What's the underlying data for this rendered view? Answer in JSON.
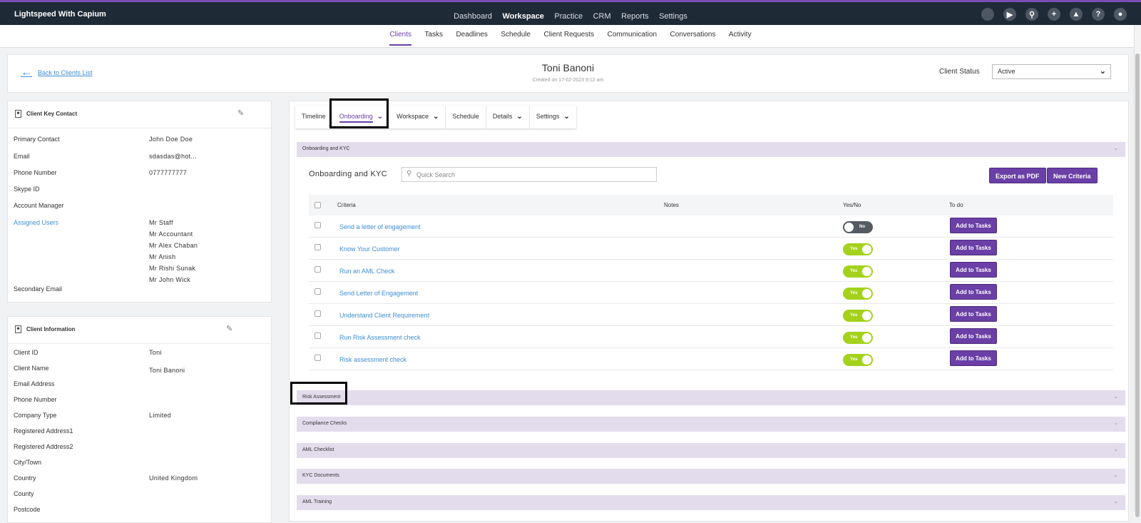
{
  "app": {
    "brand": "Lightspeed With Capium",
    "top_nav": [
      "Dashboard",
      "Workspace",
      "Practice",
      "CRM",
      "Reports",
      "Settings"
    ],
    "top_nav_active": "Workspace",
    "sub_nav": [
      "Clients",
      "Tasks",
      "Deadlines",
      "Schedule",
      "Client Requests",
      "Communication",
      "Conversations",
      "Activity"
    ],
    "sub_nav_active": "Clients",
    "icons": [
      "notification-dot-icon",
      "megaphone-icon",
      "search-icon",
      "plus-icon",
      "rocket-icon",
      "help-icon",
      "user-icon"
    ]
  },
  "header": {
    "back_label": "Back to Clients List",
    "client_name": "Toni Banoni",
    "created": "Created on 17-02-2023 9:12 am",
    "status_label": "Client Status",
    "status_value": "Active"
  },
  "key_contact": {
    "title": "Client Key Contact",
    "rows": [
      {
        "label": "Primary Contact",
        "value": "John Doe Doe"
      },
      {
        "label": "Email",
        "value": "sdasdas@hot..."
      },
      {
        "label": "Phone Number",
        "value": "0777777777"
      },
      {
        "label": "Skype ID",
        "value": ""
      },
      {
        "label": "Account Manager",
        "value": ""
      }
    ],
    "assigned_label": "Assigned Users",
    "assigned_users": [
      "Mr Staff",
      "Mr Accountant",
      "Mr Alex Chaban",
      "Mr Anish",
      "Mr Rishi Sunak",
      "Mr John Wick"
    ],
    "secondary_email_label": "Secondary Email"
  },
  "client_info": {
    "title": "Client Information",
    "rows": [
      {
        "label": "Client ID",
        "value": "Toni"
      },
      {
        "label": "Client Name",
        "value": "Toni Banoni"
      },
      {
        "label": "Email Address",
        "value": ""
      },
      {
        "label": "Phone Number",
        "value": ""
      },
      {
        "label": "Company Type",
        "value": "Limited"
      },
      {
        "label": "Registered Address1",
        "value": ""
      },
      {
        "label": "Registered Address2",
        "value": ""
      },
      {
        "label": "City/Town",
        "value": ""
      },
      {
        "label": "Country",
        "value": "United Kingdom"
      },
      {
        "label": "County",
        "value": ""
      },
      {
        "label": "Postcode",
        "value": ""
      }
    ]
  },
  "tabs": {
    "timeline": "Timeline",
    "onboarding": "Onboarding",
    "workspace": "Workspace",
    "schedule": "Schedule",
    "details": "Details",
    "settings": "Settings",
    "active": "Onboarding"
  },
  "onboarding": {
    "section_title": "Onboarding and KYC",
    "inner_title": "Onboarding and KYC",
    "search_placeholder": "Quick Search",
    "export_label": "Export as PDF",
    "new_criteria_label": "New Criteria",
    "columns": {
      "criteria": "Criteria",
      "notes": "Notes",
      "yesno": "Yes/No",
      "todo": "To do"
    },
    "add_label": "Add to Tasks",
    "rows": [
      {
        "criteria": "Send a letter of engagement",
        "state": "No"
      },
      {
        "criteria": "Know Your Customer",
        "state": "Yes"
      },
      {
        "criteria": "Run an AML Check",
        "state": "Yes"
      },
      {
        "criteria": "Send Letter of Engagement",
        "state": "Yes"
      },
      {
        "criteria": "Understand Client Requirement",
        "state": "Yes"
      },
      {
        "criteria": "Run Risk Assessment check",
        "state": "Yes"
      },
      {
        "criteria": "Risk assessment check",
        "state": "Yes"
      }
    ]
  },
  "sections": [
    "Risk Assessment",
    "Compliance Checks",
    "AML Checklist",
    "KYC Documents",
    "AML Training"
  ]
}
